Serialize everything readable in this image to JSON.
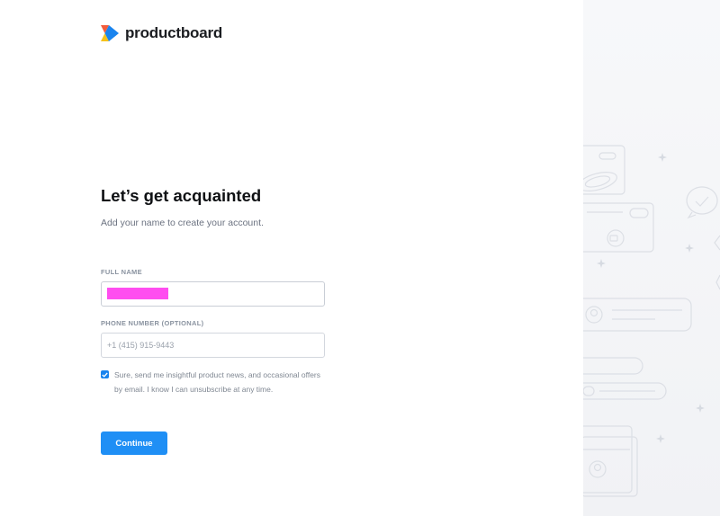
{
  "brand": {
    "name": "productboard",
    "logo_icon": "productboard-logo-icon",
    "colors": {
      "red": "#f25c3b",
      "yellow": "#f6c21a",
      "blue": "#1a84ee"
    }
  },
  "form": {
    "title": "Let’s get acquainted",
    "subtitle": "Add your name to create your account.",
    "full_name": {
      "label": "FULL NAME",
      "value": ""
    },
    "phone": {
      "label": "PHONE NUMBER (OPTIONAL)",
      "placeholder": "+1 (415) 915-9443",
      "value": ""
    },
    "consent": {
      "checked": true,
      "line1": "Sure, send me insightful product news, and occasional offers",
      "line2": "by email. I know I can unsubscribe at any time."
    },
    "submit_label": "Continue"
  },
  "accent_color": "#1f8ff5",
  "redaction_color": "#ff4df0"
}
